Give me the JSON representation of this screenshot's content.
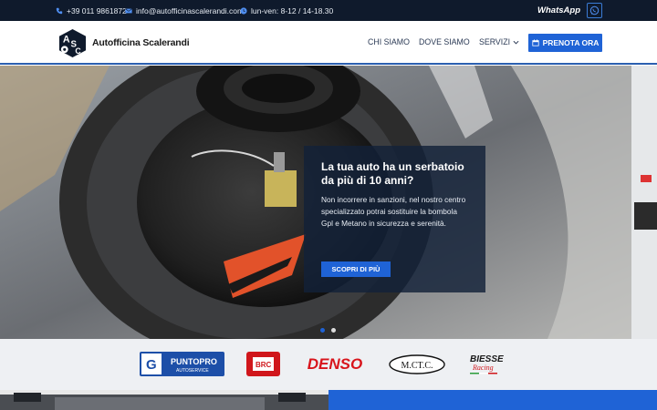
{
  "topbar": {
    "phone": "+39 011 9861872",
    "email": "info@autofficinascalerandi.com",
    "hours": "lun-ven: 8-12 / 14-18.30",
    "whatsapp": "WhatsApp"
  },
  "header": {
    "logo_text": "ASC",
    "brand": "Autofficina Scalerandi",
    "nav": {
      "chi_siamo": "CHI SIAMO",
      "dove_siamo": "DOVE SIAMO",
      "servizi": "SERVIZI"
    },
    "cta": "PRENOTA ORA"
  },
  "hero": {
    "title": "La tua auto ha un serbatoio da più di 10 anni?",
    "text": "Non incorrere in sanzioni, nel nostro centro specializzato potrai sostituire la bombola Gpl e Metano in sicurezza e serenità.",
    "button": "SCOPRI DI PIÙ",
    "slides": 2,
    "active_slide": 1
  },
  "partners": {
    "g_puntopro": "PUNTOPRO",
    "g_puntopro_sub": "AUTOSERVICE",
    "brc": "BRC",
    "denso": "DENSO",
    "mctc": "M.CT.C.",
    "biesse": "BIESSE",
    "biesse_sub": "Racing"
  },
  "colors": {
    "topbar_bg": "#0f1a2c",
    "accent": "#1f63d6",
    "card_bg": "#122138"
  }
}
